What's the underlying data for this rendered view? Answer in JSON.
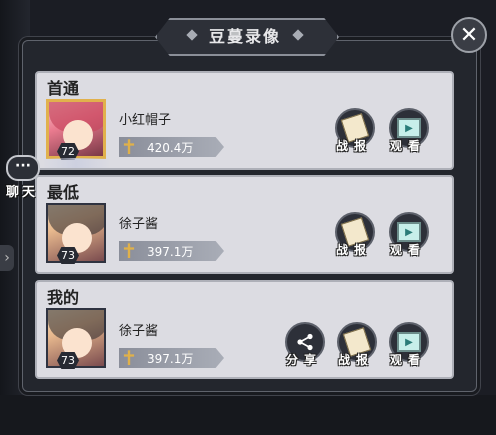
{
  "title": "豆蔓录像",
  "close_icon": "close-icon",
  "chat": {
    "label": "聊天",
    "icon": "chat-bubble-icon"
  },
  "rows": [
    {
      "label": "首通",
      "name": "小红帽子",
      "level": "72",
      "power": "420.4万",
      "avatar_frame": "gold",
      "buttons": [
        {
          "label": "战报",
          "icon": "battle-report-icon"
        },
        {
          "label": "观看",
          "icon": "watch-replay-icon"
        }
      ]
    },
    {
      "label": "最低",
      "name": "徐子酱",
      "level": "73",
      "power": "397.1万",
      "avatar_frame": "dark",
      "buttons": [
        {
          "label": "战报",
          "icon": "battle-report-icon"
        },
        {
          "label": "观看",
          "icon": "watch-replay-icon"
        }
      ]
    },
    {
      "label": "我的",
      "name": "徐子酱",
      "level": "73",
      "power": "397.1万",
      "avatar_frame": "dark",
      "buttons": [
        {
          "label": "分享",
          "icon": "share-icon"
        },
        {
          "label": "战报",
          "icon": "battle-report-icon"
        },
        {
          "label": "观看",
          "icon": "watch-replay-icon"
        }
      ]
    }
  ]
}
